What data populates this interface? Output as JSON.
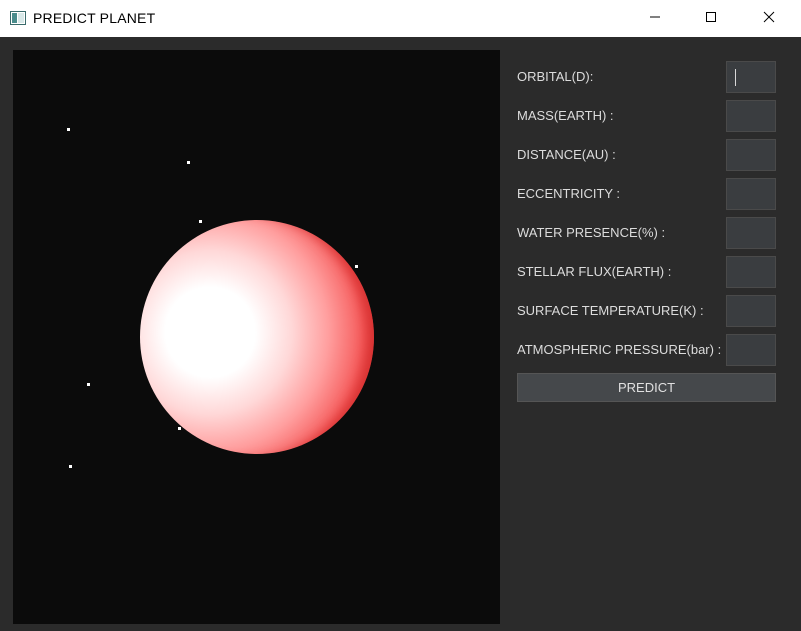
{
  "window": {
    "title": "PREDICT PLANET",
    "icons": {
      "app": "app-window-icon",
      "minimize": "minimize-icon",
      "maximize": "maximize-icon",
      "close": "close-icon"
    }
  },
  "colors": {
    "background": "#2b2b2b",
    "canvas": "#0b0b0b",
    "planet_light": "#ffffff",
    "planet_dark": "#e23a3a",
    "input_bg": "#3a3d40",
    "button_bg": "#45484b",
    "label_text": "#dcdcdc"
  },
  "form": {
    "fields": [
      {
        "label": "ORBITAL(D):",
        "value": ""
      },
      {
        "label": "MASS(EARTH) :",
        "value": ""
      },
      {
        "label": "DISTANCE(AU) :",
        "value": ""
      },
      {
        "label": "ECCENTRICITY :",
        "value": ""
      },
      {
        "label": "WATER PRESENCE(%) :",
        "value": ""
      },
      {
        "label": "STELLAR FLUX(EARTH) :",
        "value": ""
      },
      {
        "label": "SURFACE TEMPERATURE(K) :",
        "value": ""
      },
      {
        "label": "ATMOSPHERIC PRESSURE(bar) :",
        "value": ""
      }
    ],
    "predict_label": "PREDICT"
  }
}
